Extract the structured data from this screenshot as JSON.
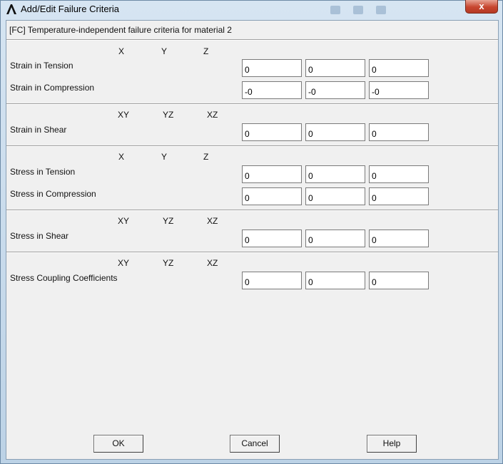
{
  "window": {
    "title": "Add/Edit Failure Criteria",
    "close_label": "x"
  },
  "header": {
    "text": "[FC] Temperature-independent failure criteria for material 2"
  },
  "sections": [
    {
      "columns": [
        "X",
        "Y",
        "Z"
      ],
      "rows": [
        {
          "label": "Strain in Tension",
          "values": [
            "0",
            "0",
            "0"
          ]
        },
        {
          "label": "Strain in Compression",
          "values": [
            "-0",
            "-0",
            "-0"
          ]
        }
      ]
    },
    {
      "columns": [
        "XY",
        "YZ",
        "XZ"
      ],
      "rows": [
        {
          "label": "Strain in Shear",
          "values": [
            "0",
            "0",
            "0"
          ]
        }
      ]
    },
    {
      "columns": [
        "X",
        "Y",
        "Z"
      ],
      "rows": [
        {
          "label": "Stress in Tension",
          "values": [
            "0",
            "0",
            "0"
          ]
        },
        {
          "label": "Stress in Compression",
          "values": [
            "0",
            "0",
            "0"
          ]
        }
      ]
    },
    {
      "columns": [
        "XY",
        "YZ",
        "XZ"
      ],
      "rows": [
        {
          "label": "Stress in Shear",
          "values": [
            "0",
            "0",
            "0"
          ]
        }
      ]
    },
    {
      "columns": [
        "XY",
        "YZ",
        "XZ"
      ],
      "rows": [
        {
          "label": "Stress Coupling Coefficients",
          "values": [
            "0",
            "0",
            "0"
          ]
        }
      ]
    }
  ],
  "buttons": {
    "ok": "OK",
    "cancel": "Cancel",
    "help": "Help"
  }
}
